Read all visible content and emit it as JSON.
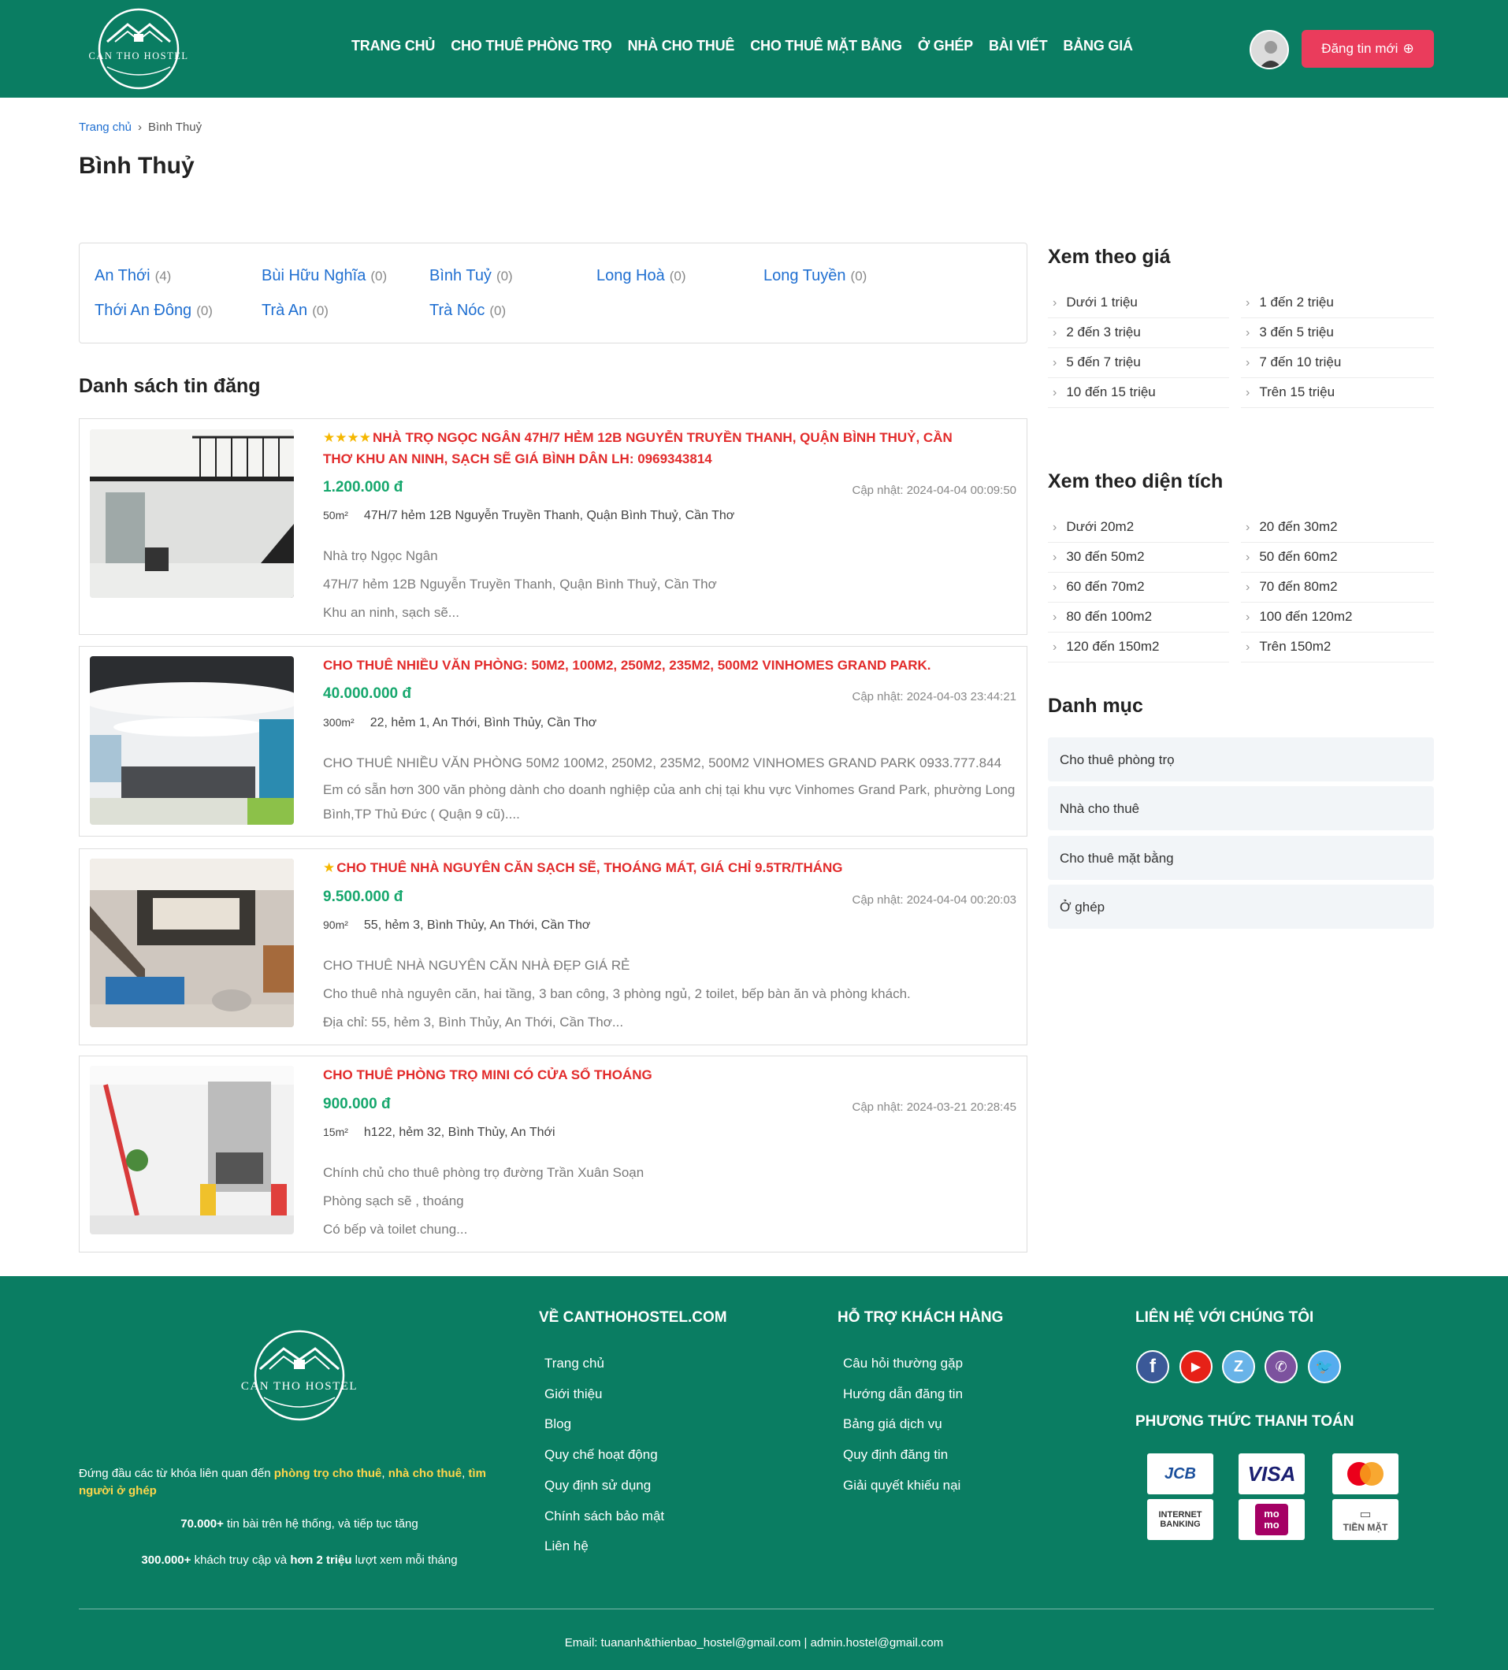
{
  "brand": {
    "logo_text": "CAN THO HOSTEL"
  },
  "nav": [
    "TRANG CHỦ",
    "CHO THUÊ PHÒNG TRỌ",
    "NHÀ CHO THUÊ",
    "CHO THUÊ MẶT BẰNG",
    "Ở GHÉP",
    "BÀI VIẾT",
    "BẢNG GIÁ"
  ],
  "header": {
    "post_button": "Đăng tin mới"
  },
  "breadcrumb": {
    "home": "Trang chủ",
    "current": "Bình Thuỷ"
  },
  "page_title": "Bình Thuỷ",
  "areas": [
    {
      "name": "An Thới",
      "count": "(4)"
    },
    {
      "name": "Bùi Hữu Nghĩa",
      "count": "(0)"
    },
    {
      "name": "Bình Tuỷ",
      "count": "(0)"
    },
    {
      "name": "Long Hoà",
      "count": "(0)"
    },
    {
      "name": "Long Tuyền",
      "count": "(0)"
    },
    {
      "name": "Thới An Đông",
      "count": "(0)"
    },
    {
      "name": "Trà An",
      "count": "(0)"
    },
    {
      "name": "Trà Nóc",
      "count": "(0)"
    }
  ],
  "list_title": "Danh sách tin đăng",
  "listings": [
    {
      "stars": 4,
      "title": "NHÀ TRỌ NGỌC NGÂN 47H/7 HẺM 12B NGUYỄN TRUYỀN THANH, QUẬN BÌNH THUỶ, CẦN THƠ KHU AN NINH, SẠCH SẼ GIÁ BÌNH DÂN LH: 0969343814",
      "price": "1.200.000 đ",
      "updated": "Cập nhật: 2024-04-04 00:09:50",
      "area": "50m²",
      "address": "47H/7 hẻm 12B Nguyễn Truyền Thanh, Quận Bình Thuỷ, Cần Thơ",
      "desc": [
        "Nhà trọ Ngọc Ngân",
        "47H/7 hẻm 12B Nguyễn Truyền Thanh, Quận Bình Thuỷ, Cần Thơ",
        "Khu an ninh, sạch sẽ..."
      ]
    },
    {
      "stars": 0,
      "title": "CHO THUÊ NHIỀU VĂN PHÒNG: 50M2, 100M2, 250M2, 235M2, 500M2 VINHOMES GRAND PARK.",
      "price": "40.000.000 đ",
      "updated": "Cập nhật: 2024-04-03 23:44:21",
      "area": "300m²",
      "address": "22, hẻm 1, An Thới, Bình Thủy, Cần Thơ",
      "desc": [
        "CHO THUÊ NHIỀU VĂN PHÒNG 50M2 100M2, 250M2, 235M2, 500M2 VINHOMES GRAND PARK 0933.777.844",
        "Em có sẵn hơn 300 văn phòng dành cho doanh nghiệp của anh chị tại khu vực Vinhomes Grand Park, phường Long Bình,TP Thủ Đức ( Quận 9 cũ)...."
      ]
    },
    {
      "stars": 1,
      "title": "CHO THUÊ NHÀ NGUYÊN CĂN SẠCH SẼ, THOÁNG MÁT, GIÁ CHỈ 9.5TR/THÁNG",
      "price": "9.500.000 đ",
      "updated": "Cập nhật: 2024-04-04 00:20:03",
      "area": "90m²",
      "address": "55, hẻm 3, Bình Thủy, An Thới, Cần Thơ",
      "desc": [
        "CHO THUÊ NHÀ NGUYÊN CĂN NHÀ ĐẸP GIÁ RẺ",
        "Cho thuê nhà nguyên căn, hai tầng, 3 ban công, 3 phòng ngủ, 2 toilet, bếp bàn ăn và phòng khách.",
        "Địa chỉ: 55, hẻm 3, Bình Thủy, An Thới, Cần Thơ..."
      ]
    },
    {
      "stars": 0,
      "title": "CHO THUÊ PHÒNG TRỌ MINI CÓ CỬA SỔ THOÁNG",
      "price": "900.000 đ",
      "updated": "Cập nhật: 2024-03-21 20:28:45",
      "area": "15m²",
      "address": "h122, hẻm 32, Bình Thủy, An Thới",
      "desc": [
        "Chính chủ cho thuê phòng trọ đường Trần Xuân Soạn",
        "Phòng sạch sẽ , thoáng",
        "Có bếp và toilet chung..."
      ]
    }
  ],
  "sidebar": {
    "price_title": "Xem theo giá",
    "price_items": [
      "Dưới 1 triệu",
      "1 đến 2 triệu",
      "2 đến 3 triệu",
      "3 đến 5 triệu",
      "5 đến 7 triệu",
      "7 đến 10 triệu",
      "10 đến 15 triệu",
      "Trên 15 triệu"
    ],
    "size_title": "Xem theo diện tích",
    "size_items": [
      "Dưới 20m2",
      "20 đến 30m2",
      "30 đến 50m2",
      "50 đến 60m2",
      "60 đến 70m2",
      "70 đến 80m2",
      "80 đến 100m2",
      "100 đến 120m2",
      "120 đến 150m2",
      "Trên 150m2"
    ],
    "cat_title": "Danh mục",
    "categories": [
      "Cho thuê phòng trọ",
      "Nhà cho thuê",
      "Cho thuê mặt bằng",
      "Ở ghép"
    ]
  },
  "footer": {
    "tag_prefix": "Đứng đầu các từ khóa liên quan đến ",
    "tag_kw1": "phòng trọ cho thuê",
    "tag_sep": ", ",
    "tag_kw2": "nhà cho thuê",
    "tag_sep2": ", ",
    "tag_kw3": "tìm",
    "tag_kw3b": "người ở ghép",
    "stat1_num": "70.000+",
    "stat1_text": " tin bài trên hệ thống, và tiếp tục tăng",
    "stat2_num": "300.000+",
    "stat2_mid": " khách truy cập và ",
    "stat2_bold": "hơn 2 triệu",
    "stat2_end": " lượt xem mỗi tháng",
    "about_title": "VỀ CANTHOHOSTEL.COM",
    "about_links": [
      "Trang chủ",
      "Giới thiệu",
      "Blog",
      "Quy chế hoạt động",
      "Quy định sử dụng",
      "Chính sách bảo mật",
      "Liên hệ"
    ],
    "support_title": "HỖ TRỢ KHÁCH HÀNG",
    "support_links": [
      "Câu hỏi thường gặp",
      "Hướng dẫn đăng tin",
      "Bảng giá dịch vụ",
      "Quy định đăng tin",
      "Giải quyết khiếu nại"
    ],
    "contact_title": "LIÊN HỆ VỚI CHÚNG TÔI",
    "payment_title": "PHƯƠNG THỨC THANH TOÁN",
    "payments": [
      "JCB",
      "VISA",
      "INTERNET BANKING",
      "mo mo",
      "TIỀN MẶT"
    ],
    "email": "Email: tuananh&thienbao_hostel@gmail.com | admin.hostel@gmail.com"
  },
  "colors": {
    "header": "#0a7d62",
    "accent": "#ea3c5c",
    "title_red": "#e22b2b",
    "price_green": "#16a76d",
    "link_blue": "#1f6fd1"
  }
}
